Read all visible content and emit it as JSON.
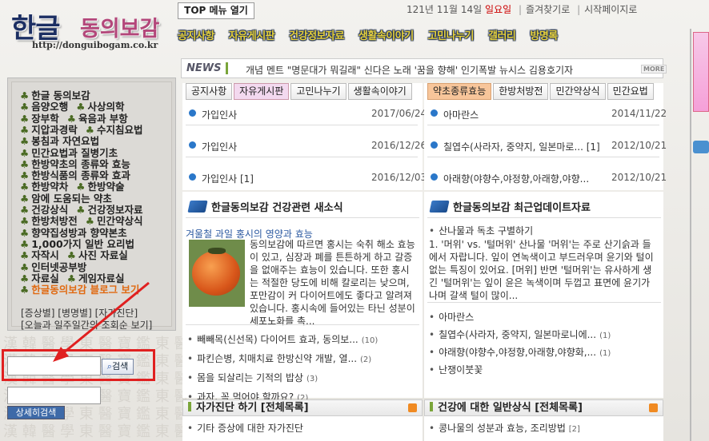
{
  "logo": {
    "hangul": "한글",
    "rest": "동의보감",
    "url": "http://donguibogam.co.kr"
  },
  "top": {
    "menu_btn": "TOP 메뉴 열기",
    "date_prefix": "121년 11월 14일",
    "weekday": "일요일",
    "bookmark": "즐겨찾기로",
    "homepage": "시작페이지로"
  },
  "nav": [
    "공지사항",
    "자유게시판",
    "건강정보자료",
    "생활속이야기",
    "고민나누기",
    "갤러리",
    "방명록"
  ],
  "news": {
    "label": "NEWS",
    "text": "개념 멘트  \"명문대가 뭐길래\" 신다은 노래 '꿈을 향해' 인기폭발      뉴시스 김용호기자",
    "more": "MORE"
  },
  "left_menu": {
    "rows": [
      [
        "한글 동의보감"
      ],
      [
        "음양오행",
        "사상의학"
      ],
      [
        "장부학",
        "육음과 부항"
      ],
      [
        "지압과경락",
        "수지침요법"
      ],
      [
        "봉침과 자연요법"
      ],
      [
        "민간요법과 질병기초"
      ],
      [
        "한방약초의 종류와 효능"
      ],
      [
        "한방식품의 종류와 효과"
      ],
      [
        "한방약차",
        "한방약술"
      ],
      [
        "암에 도움되는 약초"
      ],
      [
        "건강상식",
        "건강정보자료"
      ],
      [
        "한방처방전",
        "민간약상식"
      ],
      [
        "향약집성방과 향약본초"
      ],
      [
        "1,000가지 일반 요리법"
      ],
      [
        "자작시",
        "사진 자료실"
      ],
      [
        "인터넷공부방"
      ],
      [
        "자료실",
        "게임자료실"
      ],
      [
        "한글동의보감 블로그 보기"
      ]
    ],
    "sub1": "[증상별]  [병명별]  [자가진단]",
    "sub2": "[오늘과 일주일간의 조회순 보기]"
  },
  "search": {
    "btn": "검색",
    "detail_btn": "상세히검색"
  },
  "tabs_left": [
    "공지사항",
    "자유게시판",
    "고민나누기",
    "생활속이야기"
  ],
  "tabs_right": [
    "약초종류효능",
    "한방처방전",
    "민간약상식",
    "민간요법"
  ],
  "list_left": [
    {
      "t": "가입인사",
      "d": "2017/06/24"
    },
    {
      "t": "가입인사",
      "d": "2016/12/26"
    },
    {
      "t": "가입인사 [1]",
      "d": "2016/12/03"
    }
  ],
  "list_right": [
    {
      "t": "아마란스",
      "d": "2014/11/22"
    },
    {
      "t": "칠엽수(사라자, 중약지, 일본마로... [1]",
      "d": "2012/10/21"
    },
    {
      "t": "아래향(야향수,야정향,아래향,야향...",
      "d": "2012/10/21"
    }
  ],
  "sec_left": {
    "title": "한글동의보감 건강관련 새소식",
    "art_title": "겨울철 과일 홍시의 영양과 효능",
    "body": "동의보감에 따르면 홍시는 숙취 해소 효능이 있고, 심장과 폐를 튼튼하게 하고 갈증을 없애주는 효능이 있습니다. 또한 홍시는 적절한 당도에 비해 칼로리는 낮으며, 포만감이 커 다이어트에도 좋다고 알려져 있습니다. 홍시속에 들어있는 타닌 성분이 세포노화를 촉...",
    "items": [
      {
        "t": "빼빼목(신선목) 다이어트 효과, 동의보...",
        "c": "(10)"
      },
      {
        "t": "파킨슨병, 치매치료 한방신약 개발, 열...",
        "c": "(2)"
      },
      {
        "t": "몸을 되살리는 기적의 밥상",
        "c": "(3)"
      },
      {
        "t": "과자, 꼭 먹어야 할까요?",
        "c": "(2)"
      }
    ]
  },
  "sec_right": {
    "title": "한글동의보감 최근업데이트자료",
    "first": "산나물과 독초 구별하기",
    "body": "1. '머위' vs. '털머위' 산나물 '머위'는 주로 산기슭과 들에서 자랍니다. 잎이 연녹색이고 부드러우며 윤기와 털이 없는 특징이 있어요. [머위] 반면 '털머위'는 유사하게 생긴 '털머위'는 잎이 윤은 녹색이며 두껍고 표면에 윤기가 나며 갈색 털이 많이...",
    "items": [
      {
        "t": "아마란스",
        "c": ""
      },
      {
        "t": "칠엽수(사라자, 중약지, 일본마로니에...",
        "c": "(1)"
      },
      {
        "t": "야래향(야향수,야정향,아래향,야향화,...",
        "c": "(1)"
      },
      {
        "t": "난쟁이붓꽃",
        "c": ""
      }
    ]
  },
  "bar_left": {
    "title": "자가진단 하기 [전체목록]",
    "item": "기타 증상에 대한 자가진단"
  },
  "bar_right": {
    "title": "건강에 대한 일반상식 [전체목록]",
    "item": "콩나물의 성분과 효능, 조리방법",
    "c": "[2]"
  }
}
